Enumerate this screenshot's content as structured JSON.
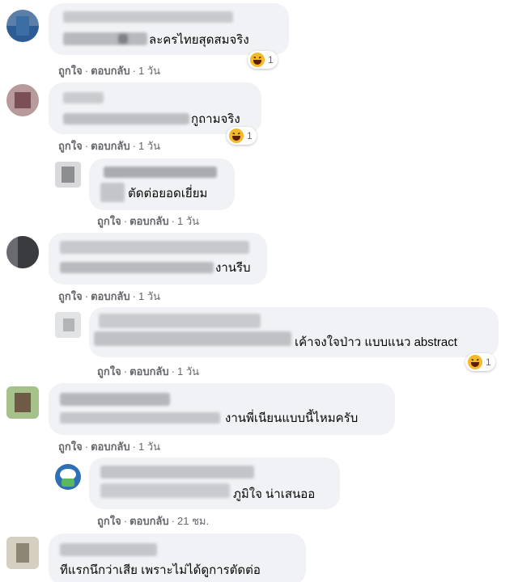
{
  "comments": [
    {
      "text": "ละครไทยสุดสมจริง",
      "reaction_count": "1",
      "time": "1 วัน"
    },
    {
      "text": "กูถามจริง",
      "reaction_count": "1",
      "time": "1 วัน"
    },
    {
      "text": "ตัดต่อยอดเยี่ยม",
      "time": "1 วัน"
    },
    {
      "text": "งานรีบ",
      "time": "1 วัน"
    },
    {
      "text": "เค้าจงใจป่าว แบบแนว abstract",
      "reaction_count": "1",
      "time": "1 วัน"
    },
    {
      "text": "งานพี่เนียนแบบนี้ไหมครับ",
      "time": "1 วัน"
    },
    {
      "text": "ภูมิใจ น่าเสนออ",
      "time": "21 ชม."
    },
    {
      "text": "ทีแรกนึกว่าเสีย เพราะไม่ได้ดูการตัดต่อ"
    }
  ],
  "actions": {
    "like": "ถูกใจ",
    "reply": "ตอบกลับ",
    "separator": "·"
  },
  "colors": {
    "bubble": "#f0f2f5",
    "meta": "#65676b",
    "haha": "#f7b928"
  },
  "icons": {
    "reaction": "haha-emoji-icon"
  }
}
